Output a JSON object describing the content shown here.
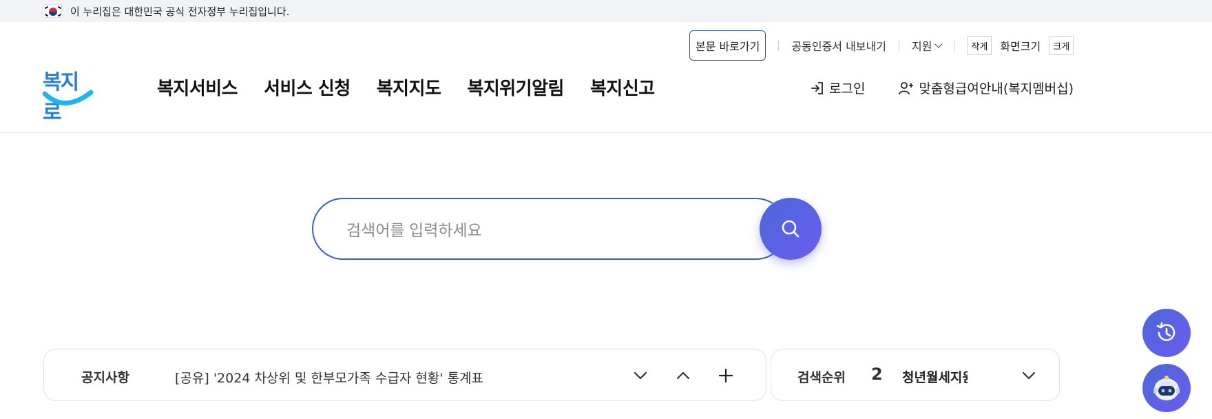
{
  "gov_banner": {
    "text": "이 누리집은 대한민국 공식 전자정부 누리집입니다."
  },
  "logo": {
    "text": "복지로"
  },
  "util": {
    "skip_label": "본문 바로가기",
    "cert_label": "공동인증서 내보내기",
    "support_label": "지원",
    "smaller_label": "작게",
    "size_label": "화면크기",
    "bigger_label": "크게"
  },
  "gnb": [
    {
      "label": "복지서비스"
    },
    {
      "label": "서비스 신청"
    },
    {
      "label": "복지지도"
    },
    {
      "label": "복지위기알림"
    },
    {
      "label": "복지신고"
    }
  ],
  "user": {
    "login_label": "로그인",
    "member_label": "맞춤형급여안내(복지멤버십)"
  },
  "search": {
    "placeholder": "검색어를 입력하세요",
    "value": ""
  },
  "notice": {
    "label": "공지사항",
    "text": "[공유] '2024 차상위 및 한부모가족 수급자 현황' 통계표"
  },
  "rank": {
    "label": "검색순위",
    "number": "2",
    "term": "청년월세지원"
  },
  "colors": {
    "accent": "#3c5cc9",
    "gradient_start": "#4a68d8",
    "gradient_end": "#6c5cf0",
    "logo_blue": "#2a7fd4",
    "logo_cyan": "#1fb6e8"
  },
  "icons": {
    "search_button": "search-icon",
    "login": "login-arrow-icon",
    "member": "user-plus-icon",
    "history": "history-clock-icon",
    "chatbot": "chatbot-robot-icon"
  }
}
